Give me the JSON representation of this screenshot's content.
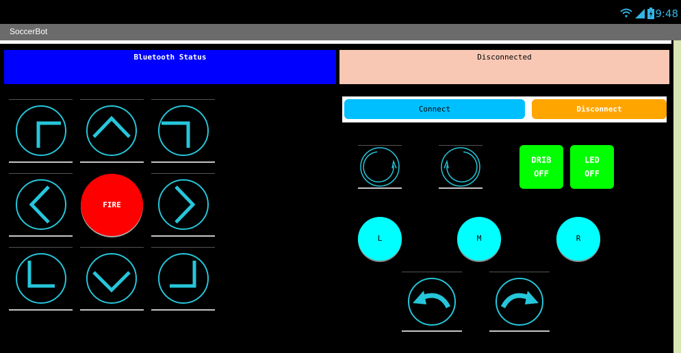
{
  "statusbar": {
    "time": "9:48"
  },
  "app": {
    "title": "SoccerBot"
  },
  "bluetooth": {
    "label": "Bluetooth Status",
    "value": "Disconnected"
  },
  "connection": {
    "connect_label": "Connect",
    "disconnect_label": "Disconnect"
  },
  "dpad": {
    "fire_label": "FIRE"
  },
  "toggles": {
    "dribbler": {
      "line1": "DRIB",
      "line2": "OFF"
    },
    "led": {
      "line1": "LED",
      "line2": "OFF"
    }
  },
  "motors": {
    "left_label": "L",
    "middle_label": "M",
    "right_label": "R"
  },
  "colors": {
    "accent": "#26c6da",
    "bluetooth_bg": "#0000ff",
    "status_bg": "#f8c8b4",
    "connect_bg": "#00bfff",
    "disconnect_bg": "#ffa500",
    "fire_bg": "#ff0000",
    "toggle_bg": "#00ff00",
    "motor_bg": "#00ffff"
  }
}
